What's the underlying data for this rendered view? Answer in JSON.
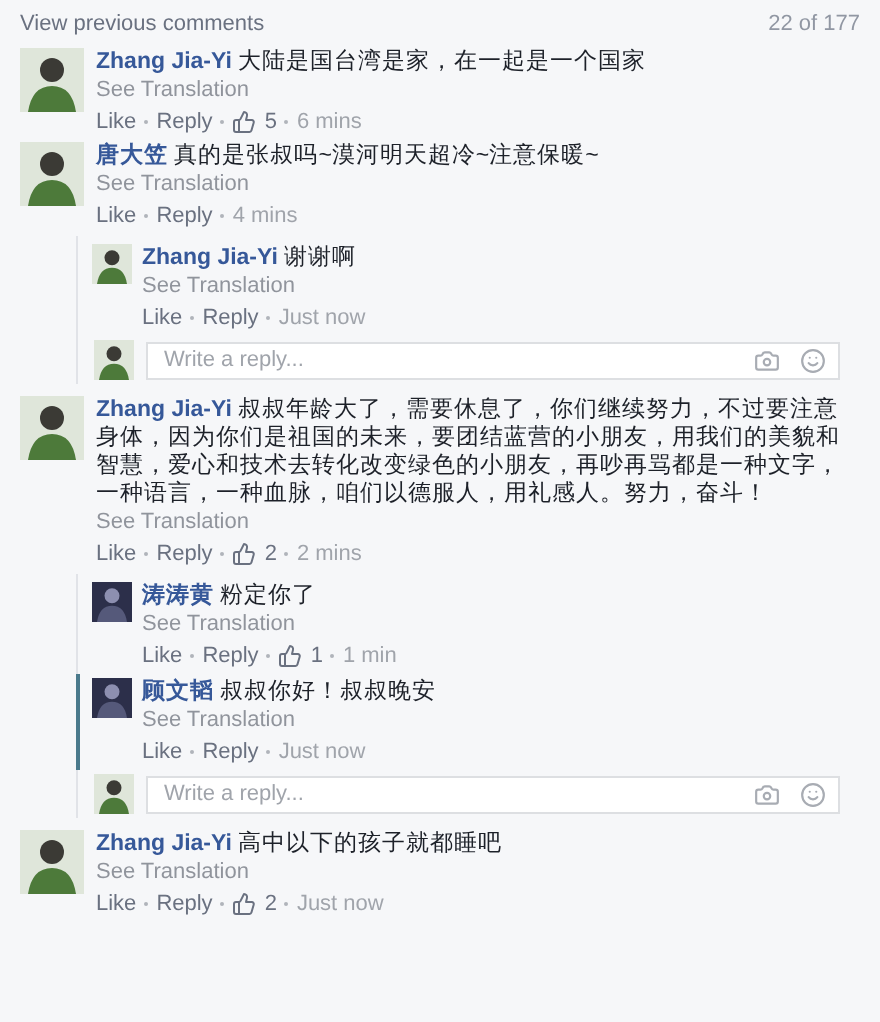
{
  "header": {
    "link": "View previous comments",
    "count": "22 of 177"
  },
  "comments": [
    {
      "author": "Zhang Jia-Yi",
      "text": "大陆是国台湾是家，在一起是一个国家",
      "translate": "See Translation",
      "actions": [
        "Like",
        "Reply"
      ],
      "likes": "5",
      "time": "6 mins"
    },
    {
      "author": "唐大笠",
      "text": "真的是张叔吗~漠河明天超冷~注意保暖~",
      "translate": "See Translation",
      "actions": [
        "Like",
        "Reply"
      ],
      "time": "4 mins",
      "replies": [
        {
          "author": "Zhang Jia-Yi",
          "text": "谢谢啊",
          "translate": "See Translation",
          "actions": [
            "Like",
            "Reply"
          ],
          "time": "Just now",
          "highlighted": false
        }
      ],
      "reply_box": {
        "placeholder": "Write a reply..."
      }
    },
    {
      "author": "Zhang Jia-Yi",
      "text": "叔叔年龄大了，需要休息了，你们继续努力，不过要注意身体，因为你们是祖国的未来，要团结蓝营的小朋友，用我们的美貌和智慧，爱心和技术去转化改变绿色的小朋友，再吵再骂都是一种文字，一种语言，一种血脉，咱们以德服人，用礼感人。努力，奋斗！",
      "translate": "See Translation",
      "actions": [
        "Like",
        "Reply"
      ],
      "likes": "2",
      "time": "2 mins",
      "replies": [
        {
          "author": "涛涛黄",
          "text": "粉定你了",
          "translate": "See Translation",
          "actions": [
            "Like",
            "Reply"
          ],
          "likes": "1",
          "time": "1 min",
          "highlighted": false
        },
        {
          "author": "顾文韬",
          "text": "叔叔你好！叔叔晚安",
          "translate": "See Translation",
          "actions": [
            "Like",
            "Reply"
          ],
          "time": "Just now",
          "highlighted": true
        }
      ],
      "reply_box": {
        "placeholder": "Write a reply..."
      }
    },
    {
      "author": "Zhang Jia-Yi",
      "text": "高中以下的孩子就都睡吧",
      "translate": "See Translation",
      "actions": [
        "Like",
        "Reply"
      ],
      "likes": "2",
      "time": "Just now"
    }
  ]
}
